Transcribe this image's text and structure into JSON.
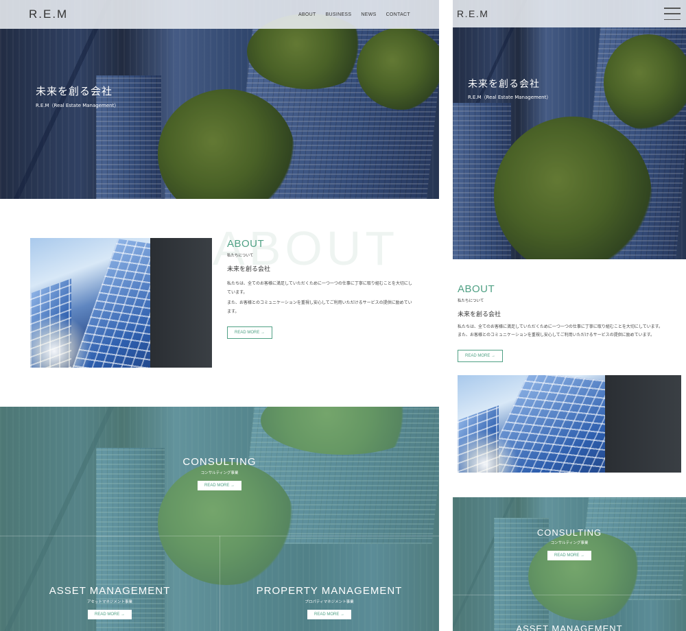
{
  "desktop": {
    "header": {
      "logo": "R.E.M",
      "nav": [
        "ABOUT",
        "BUSINESS",
        "NEWS",
        "CONTACT"
      ]
    },
    "hero": {
      "title": "未来を創る会社",
      "subtitle": "R.E.M（Real Estate Management）"
    },
    "about": {
      "ghost": "ABOUT",
      "title": "ABOUT",
      "subtitle": "私たちについて",
      "heading": "未来を創る会社",
      "body1": "私たちは、全てのお客様に満足していただくために一つ一つの仕事に丁寧に取り組むことを大切にしています。",
      "body2": "また、お客様とのコミュニケーションを重視し安心してご利用いただけるサービスの提供に励めています。",
      "button": "READ MORE →"
    },
    "business": [
      {
        "title": "CONSULTING",
        "subtitle": "コンサルティング事業",
        "button": "READ MORE →"
      },
      {
        "title": "ASSET MANAGEMENT",
        "subtitle": "アセットマネジメント事業",
        "button": "READ MORE →"
      },
      {
        "title": "PROPERTY MANAGEMENT",
        "subtitle": "プロパティマネジメント事業",
        "button": "READ MORE →"
      }
    ]
  },
  "mobile": {
    "header": {
      "logo": "R.E.M"
    },
    "hero": {
      "title": "未来を創る会社",
      "subtitle": "R.E.M（Real Estate Management）"
    },
    "about": {
      "title": "ABOUT",
      "subtitle": "私たちについて",
      "heading": "未来を創る会社",
      "body1": "私たちは、全てのお客様に満足していただくために一つ一つの仕事に丁寧に取り組むことを大切にしています。",
      "body2": "また、お客様とのコミュニケーションを重視し安心してご利用いただけるサービスの提供に励めています。",
      "button": "READ MORE →"
    },
    "business": [
      {
        "title": "CONSULTING",
        "subtitle": "コンサルティング事業",
        "button": "READ MORE →"
      },
      {
        "title": "ASSET MANAGEMENT"
      }
    ]
  },
  "colors": {
    "accent": "#4fa084",
    "header_bg": "#ebeef2",
    "teal_overlay": "#6eaf96"
  }
}
